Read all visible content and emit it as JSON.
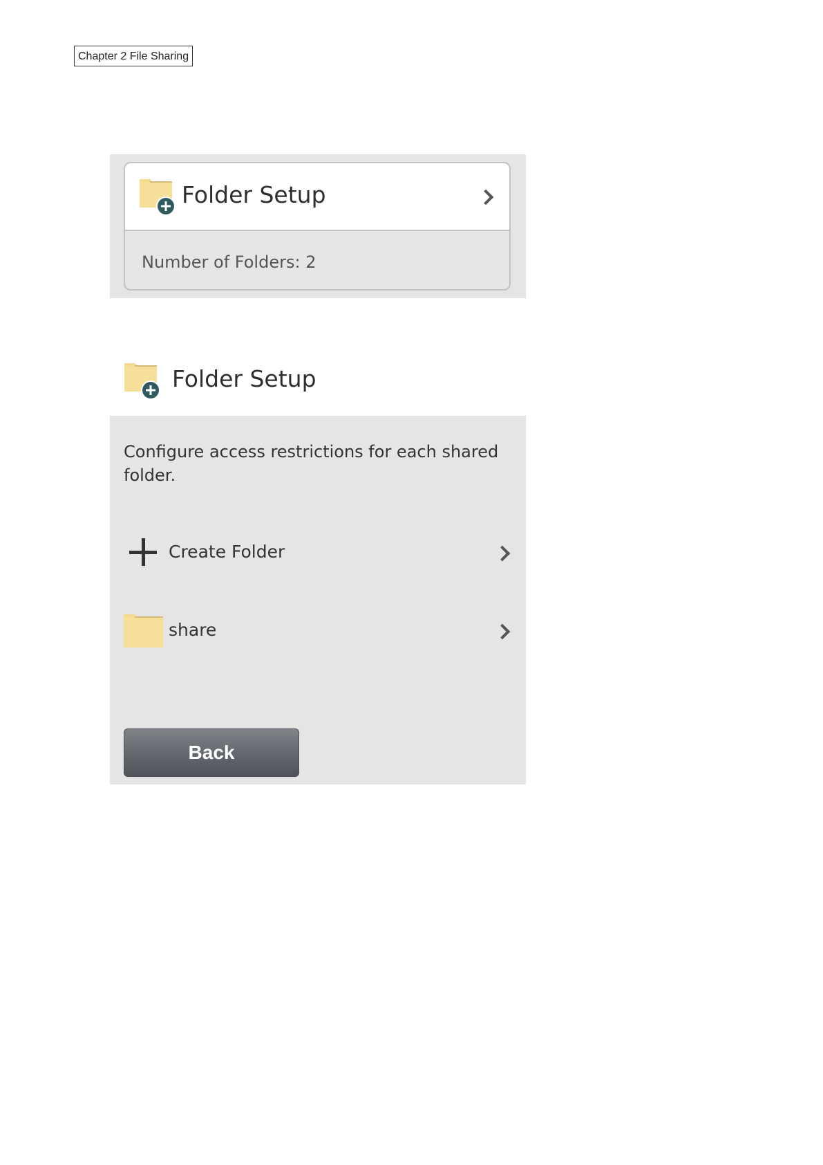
{
  "header": {
    "chapter_label": "Chapter 2 File Sharing"
  },
  "screen1": {
    "card_title": "Folder Setup",
    "folder_count_text": "Number of Folders: 2"
  },
  "screen2": {
    "title": "Folder Setup",
    "description": "Configure access restrictions for each shared folder.",
    "items": [
      {
        "label": "Create Folder",
        "icon": "plus-icon"
      },
      {
        "label": "share",
        "icon": "folder-icon"
      }
    ],
    "back_label": "Back"
  },
  "colors": {
    "folder_yellow": "#f3da8f",
    "badge_teal": "#2f5b60",
    "panel_gray": "#e5e5e5",
    "button_gray": "#62676d"
  }
}
